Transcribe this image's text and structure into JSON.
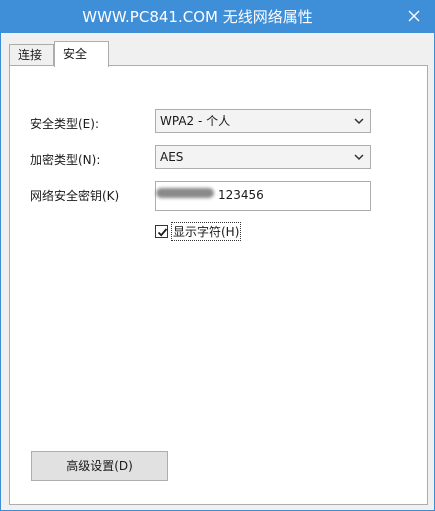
{
  "window": {
    "title": "WWW.PC841.COM 无线网络属性"
  },
  "tabs": [
    {
      "label": "连接"
    },
    {
      "label": "安全"
    }
  ],
  "security": {
    "type_label": "安全类型(E):",
    "type_value": "WPA2 - 个人",
    "encryption_label": "加密类型(N):",
    "encryption_value": "AES",
    "key_label": "网络安全密钥(K)",
    "key_value_visible": "123456",
    "show_chars_label": "显示字符(H)",
    "show_chars_checked": true
  },
  "advanced": {
    "button_label": "高级设置(D)"
  },
  "icons": {
    "close": "close-icon",
    "chevron": "chevron-down-icon",
    "check": "checkmark-icon"
  },
  "colors": {
    "titlebar": "#3e8ed8",
    "panel": "#ffffff",
    "window_bg": "#f0f0f0"
  }
}
